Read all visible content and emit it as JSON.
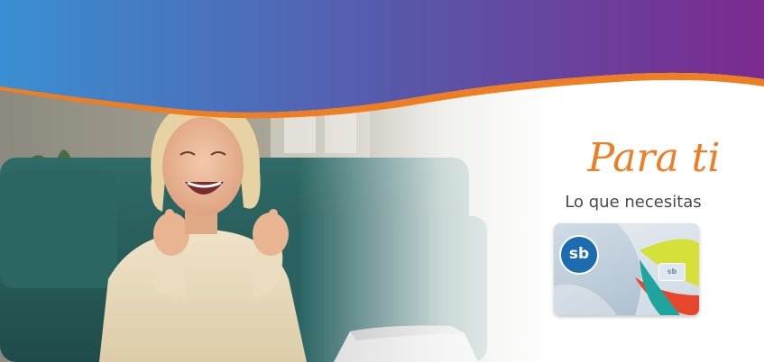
{
  "banner": {
    "title": "Para ti",
    "subtitle": "Lo que necesitas",
    "colors": {
      "gradient_start": "#3a8fd3",
      "gradient_end": "#7b2a8e",
      "accent_orange": "#ef7d22",
      "text_gray": "#4a4a4a"
    }
  },
  "card": {
    "logo_text": "sb",
    "logo_subtext": "",
    "badge_text": "sb"
  },
  "photo": {
    "icon": "woman-celebrating-laptop-photo"
  }
}
